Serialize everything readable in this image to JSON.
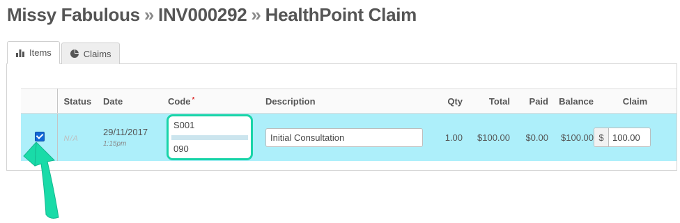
{
  "breadcrumb": {
    "patient": "Missy Fabulous",
    "separator": "»",
    "invoice": "INV000292",
    "page": "HealthPoint Claim"
  },
  "tabs": [
    {
      "label": "Items",
      "icon": "bar-chart-icon",
      "active": true
    },
    {
      "label": "Claims",
      "icon": "pie-chart-icon",
      "active": false
    }
  ],
  "table": {
    "headers": {
      "status": "Status",
      "date": "Date",
      "code": "Code",
      "code_required": "*",
      "description": "Description",
      "qty": "Qty",
      "total": "Total",
      "paid": "Paid",
      "balance": "Balance",
      "claim": "Claim"
    },
    "row": {
      "selected": true,
      "status": "N/A",
      "date": "29/11/2017",
      "time": "1:15pm",
      "code_top": "S001",
      "code_bottom": "090",
      "description": "Initial Consultation",
      "qty": "1.00",
      "total": "$100.00",
      "paid": "$0.00",
      "balance": "$100.00",
      "claim_prefix": "$",
      "claim_value": "100.00"
    }
  },
  "colors": {
    "selected_row": "#adeffa",
    "highlight": "#19d4a8",
    "checkbox": "#1167d6"
  }
}
